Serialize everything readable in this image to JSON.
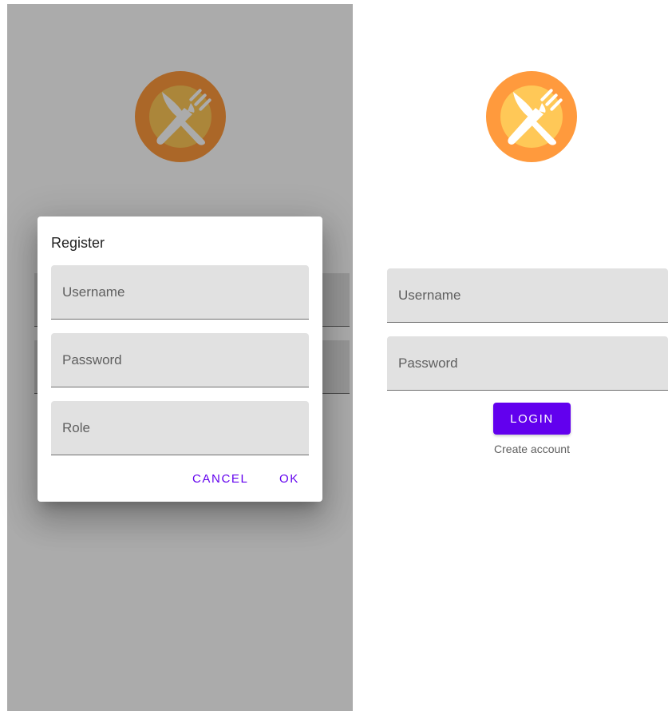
{
  "left_screen": {
    "dialog": {
      "title": "Register",
      "fields": [
        {
          "label": "Username"
        },
        {
          "label": "Password"
        },
        {
          "label": "Role"
        }
      ],
      "cancel_label": "CANCEL",
      "ok_label": "OK"
    }
  },
  "right_screen": {
    "fields": [
      {
        "label": "Username"
      },
      {
        "label": "Password"
      }
    ],
    "login_label": "LOGIN",
    "create_account_label": "Create account"
  },
  "icons": {
    "logo": "restaurant-fork-knife-icon"
  },
  "colors": {
    "primary": "#6200ee",
    "logo_outer": "#ff9a3d",
    "logo_inner": "#ffc857",
    "field_bg": "#e1e1e1",
    "scrim": "#000000"
  }
}
